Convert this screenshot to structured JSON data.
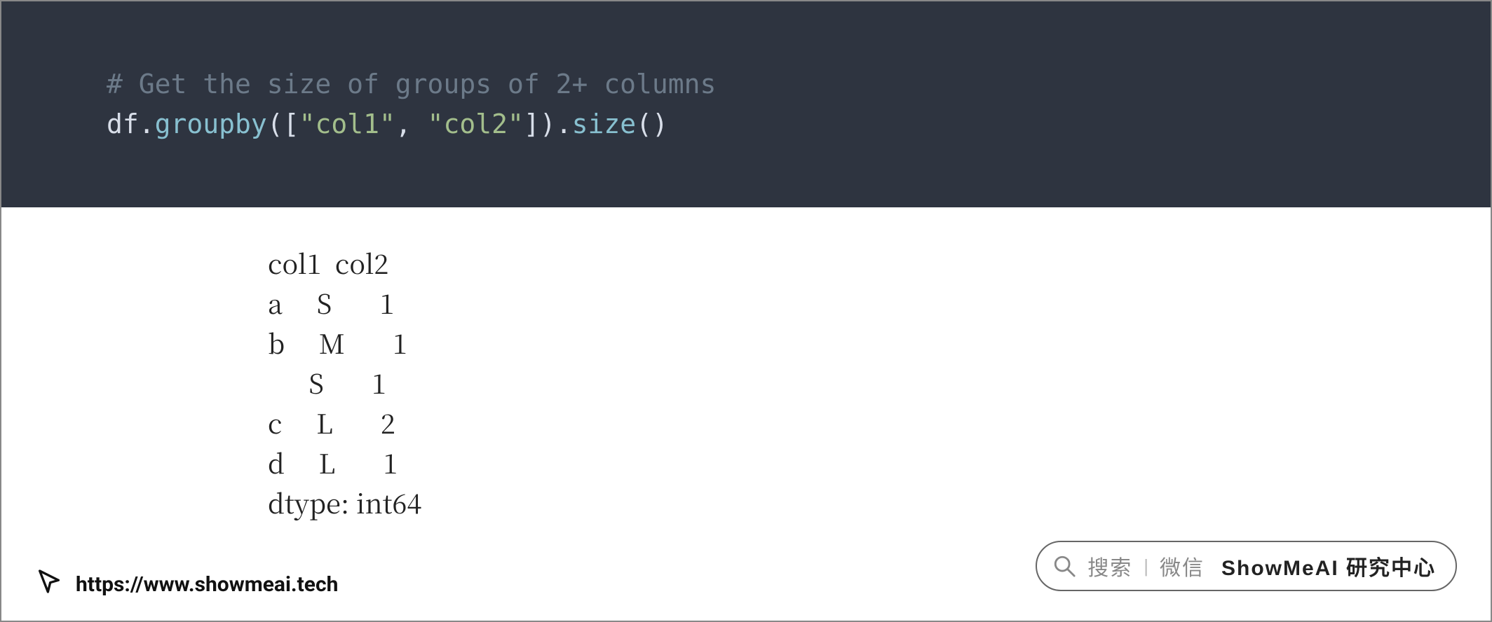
{
  "code": {
    "comment": "# Get the size of groups of 2+ columns",
    "ident_df": "df",
    "dot1": ".",
    "m_groupby": "groupby",
    "p_open": "(",
    "br_open": "[",
    "str_col1": "\"col1\"",
    "comma": ", ",
    "str_col2": "\"col2\"",
    "br_close": "]",
    "p_close": ")",
    "dot2": ".",
    "m_size": "size",
    "p_open2": "(",
    "p_close2": ")"
  },
  "output": {
    "text": "col1  col2\na     S       1\nb     M       1\n      S       1\nc     L       2\nd     L       1\ndtype: int64"
  },
  "footer": {
    "url": "https://www.showmeai.tech"
  },
  "search": {
    "label_search": "搜索",
    "separator": "|",
    "label_wechat": "微信",
    "brand": "ShowMeAI 研究中心"
  }
}
